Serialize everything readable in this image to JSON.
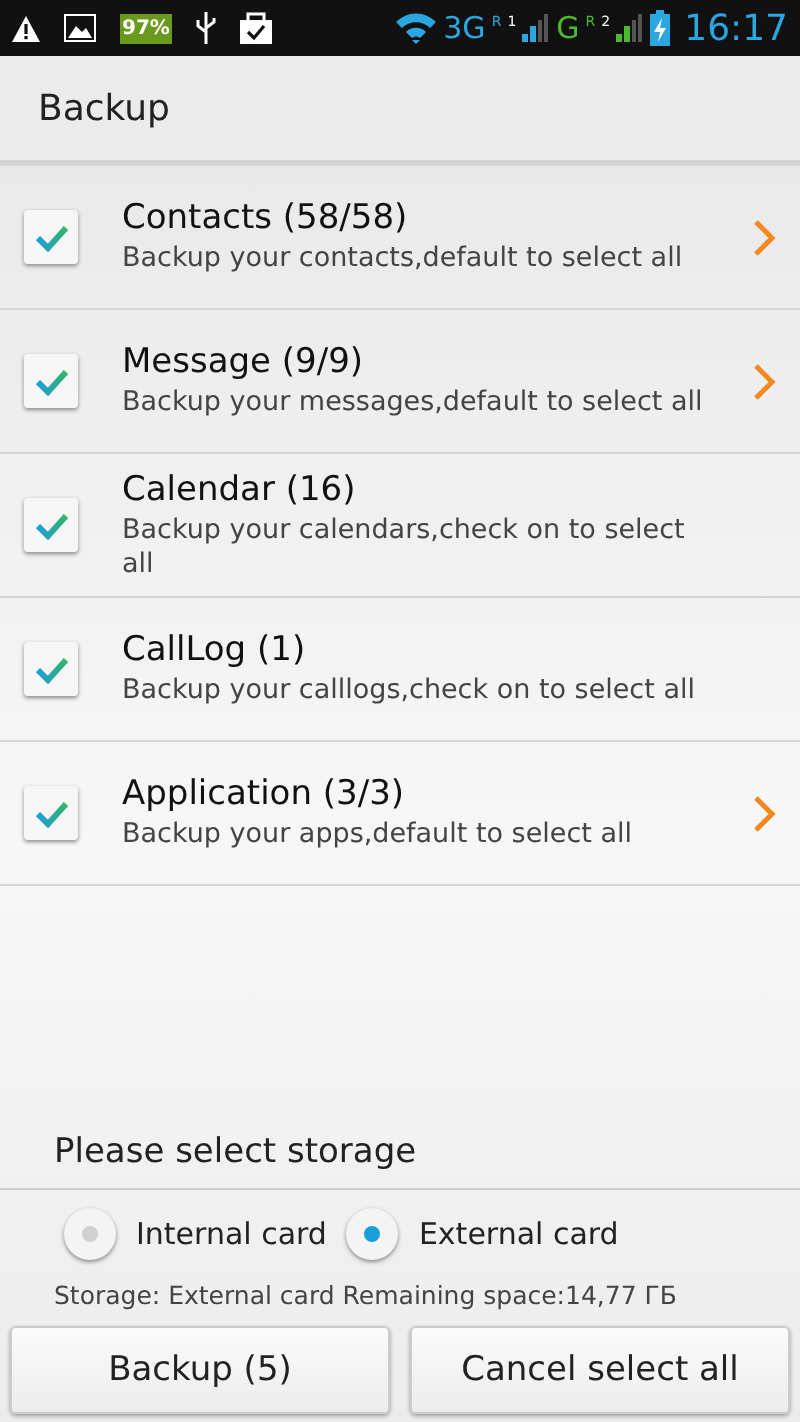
{
  "status_bar": {
    "battery_percent": "97%",
    "network_1": "3G",
    "roaming_1": "R",
    "sim_1": "1",
    "network_2": "G",
    "roaming_2": "R",
    "sim_2": "2",
    "time": "16:17"
  },
  "title": "Backup",
  "items": [
    {
      "title": "Contacts (58/58)",
      "subtitle": "Backup your contacts,default to select all",
      "checked": true,
      "has_arrow": true
    },
    {
      "title": "Message (9/9)",
      "subtitle": "Backup your messages,default to select all",
      "checked": true,
      "has_arrow": true
    },
    {
      "title": "Calendar (16)",
      "subtitle": "Backup your calendars,check on to select all",
      "checked": true,
      "has_arrow": false
    },
    {
      "title": "CallLog (1)",
      "subtitle": "Backup your calllogs,check on to select all",
      "checked": true,
      "has_arrow": false
    },
    {
      "title": "Application (3/3)",
      "subtitle": "Backup your apps,default to select all",
      "checked": true,
      "has_arrow": true
    }
  ],
  "storage": {
    "heading": "Please select storage",
    "options": [
      {
        "label": "Internal card",
        "selected": false
      },
      {
        "label": "External card",
        "selected": true
      }
    ],
    "info": "Storage: External card Remaining space:14,77 ГБ"
  },
  "buttons": [
    "Backup (5)",
    "Cancel select all"
  ]
}
